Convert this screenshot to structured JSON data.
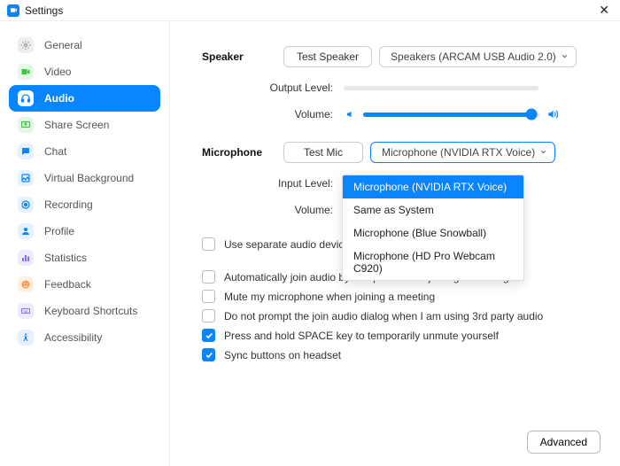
{
  "window": {
    "title": "Settings"
  },
  "sidebar": {
    "items": [
      {
        "label": "General",
        "icon": "gear"
      },
      {
        "label": "Video",
        "icon": "video"
      },
      {
        "label": "Audio",
        "icon": "headphones",
        "active": true
      },
      {
        "label": "Share Screen",
        "icon": "share"
      },
      {
        "label": "Chat",
        "icon": "chat"
      },
      {
        "label": "Virtual Background",
        "icon": "background"
      },
      {
        "label": "Recording",
        "icon": "record"
      },
      {
        "label": "Profile",
        "icon": "profile"
      },
      {
        "label": "Statistics",
        "icon": "stats"
      },
      {
        "label": "Feedback",
        "icon": "feedback"
      },
      {
        "label": "Keyboard Shortcuts",
        "icon": "keyboard"
      },
      {
        "label": "Accessibility",
        "icon": "accessibility"
      }
    ]
  },
  "speaker": {
    "heading": "Speaker",
    "test_label": "Test Speaker",
    "device": "Speakers (ARCAM USB Audio 2.0)",
    "output_label": "Output Level:",
    "volume_label": "Volume:",
    "volume_percent": 95
  },
  "microphone": {
    "heading": "Microphone",
    "test_label": "Test Mic",
    "device": "Microphone (NVIDIA RTX Voice)",
    "input_label": "Input Level:",
    "volume_label": "Volume:",
    "dropdown_open": true,
    "options": [
      "Microphone (NVIDIA RTX Voice)",
      "Same as System",
      "Microphone (Blue Snowball)",
      "Microphone (HD Pro Webcam C920)"
    ],
    "selected_index": 0
  },
  "checkboxes": [
    {
      "label": "Use separate audio device to play ringtone simultaneously",
      "checked": false
    },
    {
      "label": "Automatically join audio by computer when joining a meeting",
      "checked": false
    },
    {
      "label": "Mute my microphone when joining a meeting",
      "checked": false
    },
    {
      "label": "Do not prompt the join audio dialog when I am using 3rd party audio",
      "checked": false
    },
    {
      "label": "Press and hold SPACE key to temporarily unmute yourself",
      "checked": true
    },
    {
      "label": "Sync buttons on headset",
      "checked": true
    }
  ],
  "advanced_label": "Advanced"
}
